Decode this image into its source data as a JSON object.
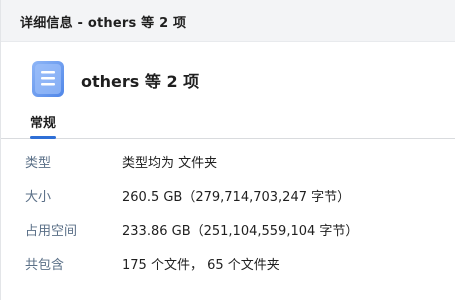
{
  "window": {
    "title": "详细信息 - others 等 2 项"
  },
  "header": {
    "title": "others 等 2 项",
    "icon": "folder-document-icon",
    "accent_color": "#2f6fd6"
  },
  "tabs": [
    {
      "label": "常规",
      "selected": true
    }
  ],
  "properties": [
    {
      "label": "类型",
      "value": "类型均为 文件夹"
    },
    {
      "label": "大小",
      "value": "260.5 GB（279,714,703,247 字节）"
    },
    {
      "label": "占用空间",
      "value": "233.86 GB（251,104,559,104 字节）"
    },
    {
      "label": "共包含",
      "value": "175 个文件，  65 个文件夹"
    }
  ]
}
